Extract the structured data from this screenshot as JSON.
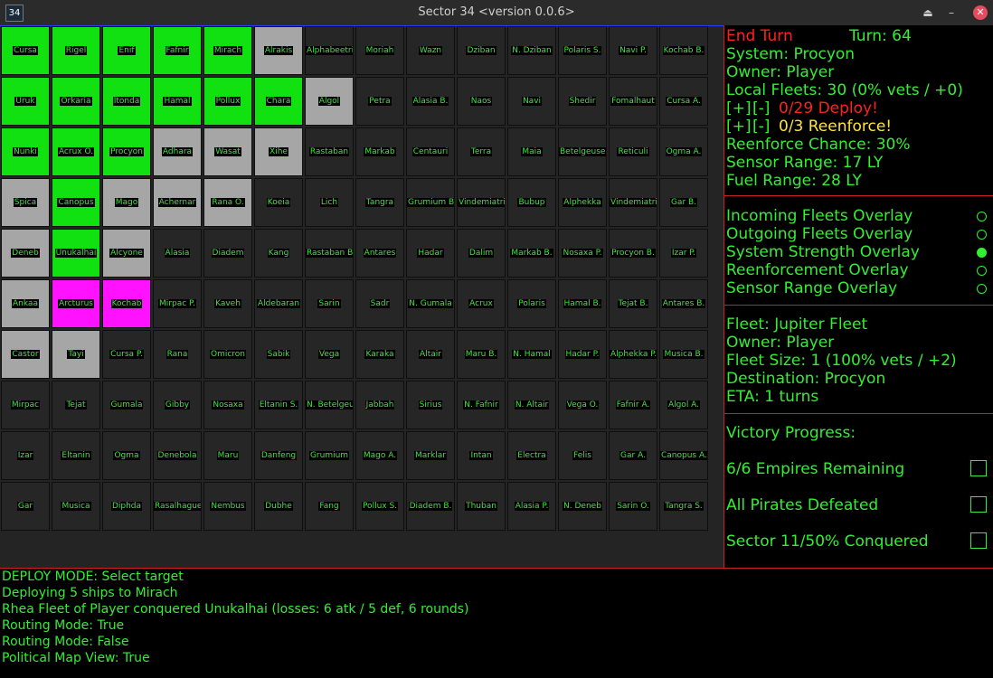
{
  "window": {
    "title": "Sector 34   <version 0.0.6>",
    "icon_label": "34",
    "buttons": [
      "eject-icon",
      "minimize-icon",
      "close-icon"
    ]
  },
  "colors": {
    "player": "#11e011",
    "neutral": "#a6a6a6",
    "enemy": "#ff12ff",
    "empty": "#262626",
    "text": "#33ee33",
    "alert": "#ff2020",
    "warn": "#ffe23a"
  },
  "map": {
    "rows": [
      [
        [
          "Cursa",
          "P"
        ],
        [
          "Rigel",
          "P"
        ],
        [
          "Enif",
          "P"
        ],
        [
          "Fafnir",
          "P"
        ],
        [
          "Mirach",
          "P"
        ],
        [
          "Alrakis",
          "N"
        ],
        [
          "Alphabeetrium",
          ""
        ],
        [
          "Moriah",
          ""
        ],
        [
          "Wazn",
          ""
        ],
        [
          "Dziban",
          ""
        ],
        [
          "N. Dziban",
          ""
        ],
        [
          "Polaris S.",
          ""
        ],
        [
          "Navi P.",
          ""
        ],
        [
          "Kochab B.",
          ""
        ]
      ],
      [
        [
          "Uruk",
          "P"
        ],
        [
          "Orkaria",
          "P"
        ],
        [
          "Itonda",
          "P"
        ],
        [
          "Hamal",
          "P"
        ],
        [
          "Pollux",
          "P"
        ],
        [
          "Chara",
          "P"
        ],
        [
          "Algol",
          "N"
        ],
        [
          "Petra",
          ""
        ],
        [
          "Alasia B.",
          ""
        ],
        [
          "Naos",
          ""
        ],
        [
          "Navi",
          ""
        ],
        [
          "Shedir",
          ""
        ],
        [
          "Fomalhaut",
          ""
        ],
        [
          "Cursa A.",
          ""
        ]
      ],
      [
        [
          "Nunki",
          "P"
        ],
        [
          "Acrux O.",
          "P"
        ],
        [
          "Procyon",
          "P"
        ],
        [
          "Adhara",
          "N"
        ],
        [
          "Wasat",
          "N"
        ],
        [
          "Xihe",
          "N"
        ],
        [
          "Rastaban",
          ""
        ],
        [
          "Markab",
          ""
        ],
        [
          "Centauri",
          ""
        ],
        [
          "Terra",
          ""
        ],
        [
          "Maia",
          ""
        ],
        [
          "Betelgeuse",
          ""
        ],
        [
          "Reticuli",
          ""
        ],
        [
          "Ogma A.",
          ""
        ]
      ],
      [
        [
          "Spica",
          "N"
        ],
        [
          "Canopus",
          "P"
        ],
        [
          "Mago",
          "N"
        ],
        [
          "Achernar",
          "N"
        ],
        [
          "Rana O.",
          "N"
        ],
        [
          "Koeia",
          ""
        ],
        [
          "Lich",
          ""
        ],
        [
          "Tangra",
          ""
        ],
        [
          "Grumium B.",
          ""
        ],
        [
          "Vindemiatrix",
          ""
        ],
        [
          "Bubup",
          ""
        ],
        [
          "Alphekka",
          ""
        ],
        [
          "Vindemiatrix P.",
          ""
        ],
        [
          "Gar B.",
          ""
        ]
      ],
      [
        [
          "Deneb",
          "N"
        ],
        [
          "Unukalhai",
          "P"
        ],
        [
          "Alcyone",
          "N"
        ],
        [
          "Alasia",
          ""
        ],
        [
          "Diadem",
          ""
        ],
        [
          "Kang",
          ""
        ],
        [
          "Rastaban B.",
          ""
        ],
        [
          "Antares",
          ""
        ],
        [
          "Hadar",
          ""
        ],
        [
          "Dalim",
          ""
        ],
        [
          "Markab B.",
          ""
        ],
        [
          "Nosaxa P.",
          ""
        ],
        [
          "Procyon B.",
          ""
        ],
        [
          "Izar P.",
          ""
        ]
      ],
      [
        [
          "Ankaa",
          "N"
        ],
        [
          "Arcturus",
          "E"
        ],
        [
          "Kochab",
          "E"
        ],
        [
          "Mirpac P.",
          ""
        ],
        [
          "Kaveh",
          ""
        ],
        [
          "Aldebaran",
          ""
        ],
        [
          "Sarin",
          ""
        ],
        [
          "Sadr",
          ""
        ],
        [
          "N. Gumala",
          ""
        ],
        [
          "Acrux",
          ""
        ],
        [
          "Polaris",
          ""
        ],
        [
          "Hamal B.",
          ""
        ],
        [
          "Tejat B.",
          ""
        ],
        [
          "Antares B.",
          ""
        ]
      ],
      [
        [
          "Castor",
          "N"
        ],
        [
          "Tayi",
          "N"
        ],
        [
          "Cursa P.",
          ""
        ],
        [
          "Rana",
          ""
        ],
        [
          "Omicron",
          ""
        ],
        [
          "Sabik",
          ""
        ],
        [
          "Vega",
          ""
        ],
        [
          "Karaka",
          ""
        ],
        [
          "Altair",
          ""
        ],
        [
          "Maru B.",
          ""
        ],
        [
          "N. Hamal",
          ""
        ],
        [
          "Hadar P.",
          ""
        ],
        [
          "Alphekka P.",
          ""
        ],
        [
          "Musica B.",
          ""
        ]
      ],
      [
        [
          "Mirpac",
          ""
        ],
        [
          "Tejat",
          ""
        ],
        [
          "Gumala",
          ""
        ],
        [
          "Gibby",
          ""
        ],
        [
          "Nosaxa",
          ""
        ],
        [
          "Eltanin S.",
          ""
        ],
        [
          "N. Betelgeuse",
          ""
        ],
        [
          "Jabbah",
          ""
        ],
        [
          "Sirius",
          ""
        ],
        [
          "N. Fafnir",
          ""
        ],
        [
          "N. Altair",
          ""
        ],
        [
          "Vega O.",
          ""
        ],
        [
          "Fafnir A.",
          ""
        ],
        [
          "Algol A.",
          ""
        ]
      ],
      [
        [
          "Izar",
          ""
        ],
        [
          "Eltanin",
          ""
        ],
        [
          "Ogma",
          ""
        ],
        [
          "Denebola",
          ""
        ],
        [
          "Maru",
          ""
        ],
        [
          "Danfeng",
          ""
        ],
        [
          "Grumium",
          ""
        ],
        [
          "Mago A.",
          ""
        ],
        [
          "Marklar",
          ""
        ],
        [
          "Intan",
          ""
        ],
        [
          "Electra",
          ""
        ],
        [
          "Felis",
          ""
        ],
        [
          "Gar A.",
          ""
        ],
        [
          "Canopus A.",
          ""
        ]
      ],
      [
        [
          "Gar",
          ""
        ],
        [
          "Musica",
          ""
        ],
        [
          "Diphda",
          ""
        ],
        [
          "Rasalhague",
          ""
        ],
        [
          "Nembus",
          ""
        ],
        [
          "Dubhe",
          ""
        ],
        [
          "Fang",
          ""
        ],
        [
          "Pollux S.",
          ""
        ],
        [
          "Diadem B.",
          ""
        ],
        [
          "Thuban",
          ""
        ],
        [
          "Alasia P.",
          ""
        ],
        [
          "N. Deneb",
          ""
        ],
        [
          "Sarin O.",
          ""
        ],
        [
          "Tangra S.",
          ""
        ]
      ]
    ]
  },
  "status": {
    "end_turn": "End Turn",
    "turn": "Turn: 64",
    "system": "System: Procyon",
    "owner": "Owner: Player",
    "local_fleets": "Local Fleets: 30 (0% vets / +0)",
    "deploy_plus": "[+]",
    "deploy_minus": "[-]",
    "deploy": "0/29 Deploy!",
    "reenforce_plus": "[+]",
    "reenforce_minus": "[-]",
    "reenforce": "0/3 Reenforce!",
    "reenforce_chance": "Reenforce Chance: 30%",
    "sensor_range": "Sensor Range: 17 LY",
    "fuel_range": "Fuel Range: 28 LY"
  },
  "overlays": [
    {
      "label": "Incoming Fleets Overlay",
      "on": false
    },
    {
      "label": "Outgoing Fleets Overlay",
      "on": false
    },
    {
      "label": "System Strength Overlay",
      "on": true
    },
    {
      "label": "Reenforcement Overlay",
      "on": false
    },
    {
      "label": "Sensor Range Overlay",
      "on": false
    }
  ],
  "fleet": {
    "name": "Fleet: Jupiter Fleet",
    "owner": "Owner: Player",
    "size": "Fleet Size: 1 (100% vets / +2)",
    "destination": "Destination: Procyon",
    "eta": "ETA: 1 turns"
  },
  "victory": {
    "title": "Victory Progress:",
    "items": [
      {
        "label": "6/6 Empires Remaining",
        "checked": false
      },
      {
        "label": "All Pirates Defeated",
        "checked": false
      },
      {
        "label": "Sector 11/50% Conquered",
        "checked": false
      }
    ]
  },
  "log": [
    "DEPLOY MODE: Select target",
    "Deploying 5 ships to Mirach",
    "Rhea Fleet of Player conquered Unukalhai (losses: 6 atk / 5 def, 6 rounds)",
    "Routing Mode: True",
    "Routing Mode: False",
    "Political Map View: True"
  ]
}
